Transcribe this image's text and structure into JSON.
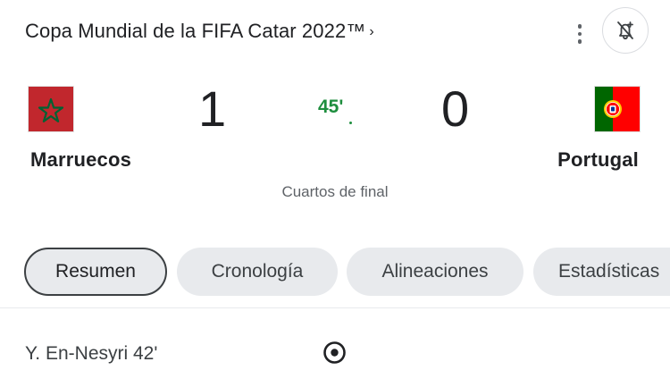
{
  "header": {
    "title": "Copa Mundial de la FIFA Catar 2022™",
    "title_chevron": "›",
    "more_icon": "more-vert-icon",
    "bell_icon": "notification-add-icon"
  },
  "match": {
    "home": {
      "name": "Marruecos",
      "score": "1",
      "flag_icon": "morocco-flag-icon"
    },
    "away": {
      "name": "Portugal",
      "score": "0",
      "flag_icon": "portugal-flag-icon"
    },
    "minute": "45'",
    "stage": "Cuartos de final",
    "live_color": "#1e8e3e"
  },
  "tabs": [
    {
      "label": "Resumen",
      "active": true
    },
    {
      "label": "Cronología",
      "active": false
    },
    {
      "label": "Alineaciones",
      "active": false
    },
    {
      "label": "Estadísticas",
      "active": false
    }
  ],
  "events": [
    {
      "text": "Y. En-Nesyri 42'",
      "icon": "soccer-ball-icon"
    }
  ]
}
